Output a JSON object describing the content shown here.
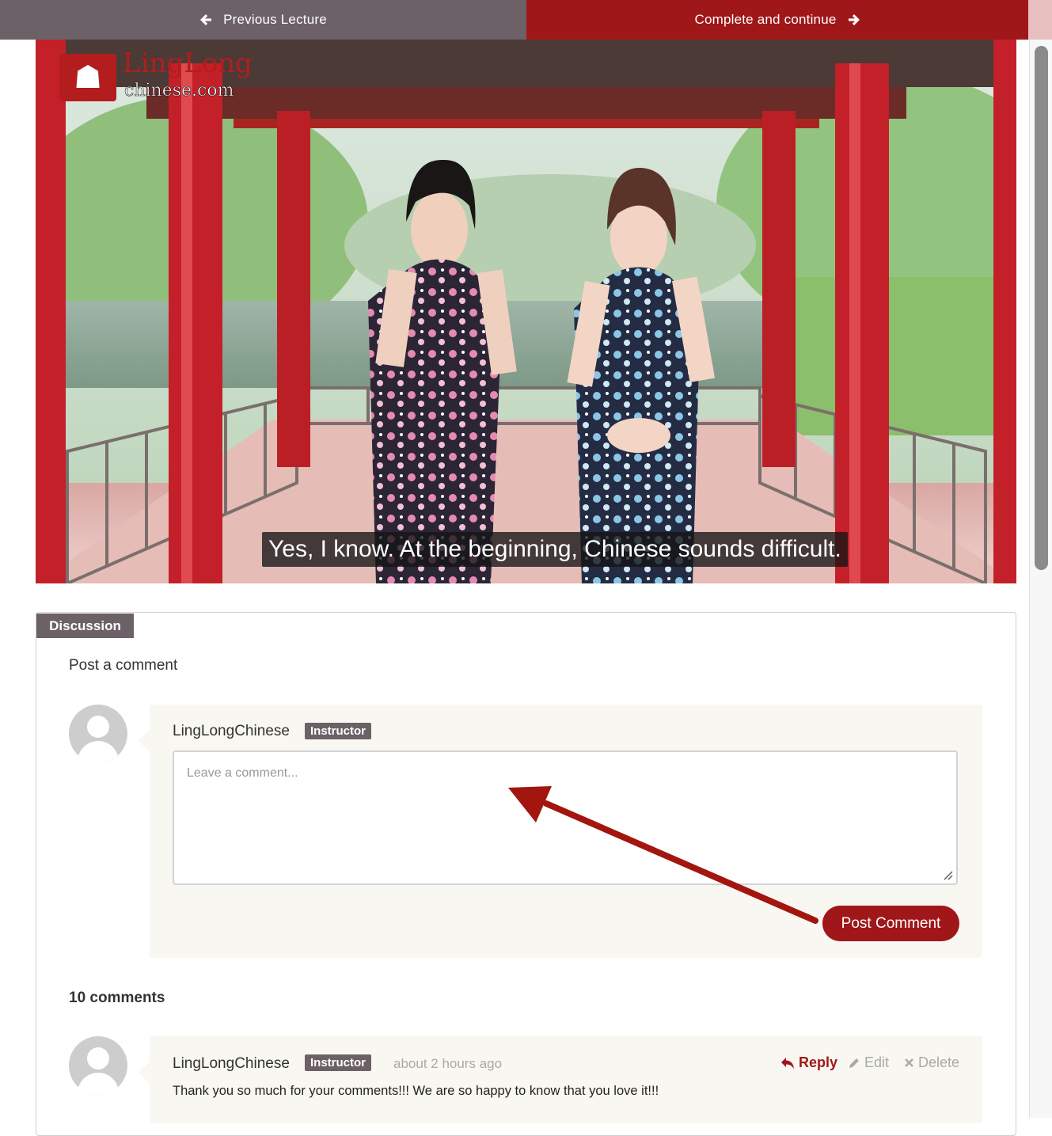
{
  "nav": {
    "prev_label": "Previous Lecture",
    "next_label": "Complete and continue",
    "prev_color": "#6b6166",
    "next_color": "#a0171a"
  },
  "video": {
    "subtitle": "Yes, I know. At the beginning, Chinese sounds difficult.",
    "logo_text": "LingLong",
    "logo_subtext": "chinese.com"
  },
  "discussion": {
    "tab_label": "Discussion",
    "post_heading": "Post a comment",
    "composer": {
      "author": "LingLongChinese",
      "badge": "Instructor",
      "placeholder": "Leave a comment...",
      "submit_label": "Post Comment"
    },
    "comment_count": "10 comments",
    "comments": [
      {
        "author": "LingLongChinese",
        "badge": "Instructor",
        "time": "about 2 hours ago",
        "reply_label": "Reply",
        "edit_label": "Edit",
        "delete_label": "Delete",
        "text": "Thank you so much for your comments!!! We are so happy to know that you love it!!!"
      }
    ]
  },
  "colors": {
    "accent": "#a0171a",
    "badge": "#6b6166",
    "comment_bg": "#f8f7f1"
  }
}
